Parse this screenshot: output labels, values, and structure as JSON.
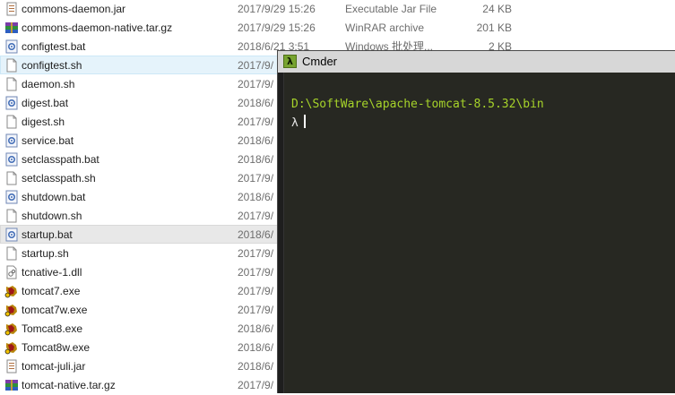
{
  "files": [
    {
      "name": "commons-daemon.jar",
      "date": "2017/9/29 15:26",
      "type": "Executable Jar File",
      "size": "24 KB",
      "icon": "jar-icon"
    },
    {
      "name": "commons-daemon-native.tar.gz",
      "date": "2017/9/29 15:26",
      "type": "WinRAR archive",
      "size": "201 KB",
      "icon": "archive-icon"
    },
    {
      "name": "configtest.bat",
      "date": "2018/6/21 3:51",
      "type": "Windows 批处理...",
      "size": "2 KB",
      "icon": "bat-icon"
    },
    {
      "name": "configtest.sh",
      "date": "2017/9/",
      "type": "",
      "size": "",
      "icon": "text-file-icon"
    },
    {
      "name": "daemon.sh",
      "date": "2017/9/",
      "type": "",
      "size": "",
      "icon": "text-file-icon"
    },
    {
      "name": "digest.bat",
      "date": "2018/6/",
      "type": "",
      "size": "",
      "icon": "bat-icon"
    },
    {
      "name": "digest.sh",
      "date": "2017/9/",
      "type": "",
      "size": "",
      "icon": "text-file-icon"
    },
    {
      "name": "service.bat",
      "date": "2018/6/",
      "type": "",
      "size": "",
      "icon": "bat-icon"
    },
    {
      "name": "setclasspath.bat",
      "date": "2018/6/",
      "type": "",
      "size": "",
      "icon": "bat-icon"
    },
    {
      "name": "setclasspath.sh",
      "date": "2017/9/",
      "type": "",
      "size": "",
      "icon": "text-file-icon"
    },
    {
      "name": "shutdown.bat",
      "date": "2018/6/",
      "type": "",
      "size": "",
      "icon": "bat-icon"
    },
    {
      "name": "shutdown.sh",
      "date": "2017/9/",
      "type": "",
      "size": "",
      "icon": "text-file-icon"
    },
    {
      "name": "startup.bat",
      "date": "2018/6/",
      "type": "",
      "size": "",
      "icon": "bat-icon"
    },
    {
      "name": "startup.sh",
      "date": "2017/9/",
      "type": "",
      "size": "",
      "icon": "text-file-icon"
    },
    {
      "name": "tcnative-1.dll",
      "date": "2017/9/",
      "type": "",
      "size": "",
      "icon": "dll-icon"
    },
    {
      "name": "tomcat7.exe",
      "date": "2017/9/",
      "type": "",
      "size": "",
      "icon": "tomcat-exe-icon"
    },
    {
      "name": "tomcat7w.exe",
      "date": "2017/9/",
      "type": "",
      "size": "",
      "icon": "tomcat-exe-icon"
    },
    {
      "name": "Tomcat8.exe",
      "date": "2018/6/",
      "type": "",
      "size": "",
      "icon": "tomcat-exe-icon"
    },
    {
      "name": "Tomcat8w.exe",
      "date": "2018/6/",
      "type": "",
      "size": "",
      "icon": "tomcat-exe-icon"
    },
    {
      "name": "tomcat-juli.jar",
      "date": "2018/6/",
      "type": "",
      "size": "",
      "icon": "jar-icon"
    },
    {
      "name": "tomcat-native.tar.gz",
      "date": "2017/9/",
      "type": "",
      "size": "",
      "icon": "archive-icon"
    }
  ],
  "hover_row": 3,
  "selected_row": 12,
  "cmder": {
    "title": "Cmder",
    "logo": "λ",
    "path": "D:\\SoftWare\\apache-tomcat-8.5.32\\bin",
    "prompt": "λ"
  },
  "colors": {
    "terminal_bg": "#272822",
    "path_green": "#a6d32a",
    "row_hover": "#e5f3fb",
    "row_selected": "#e8e8e8"
  }
}
